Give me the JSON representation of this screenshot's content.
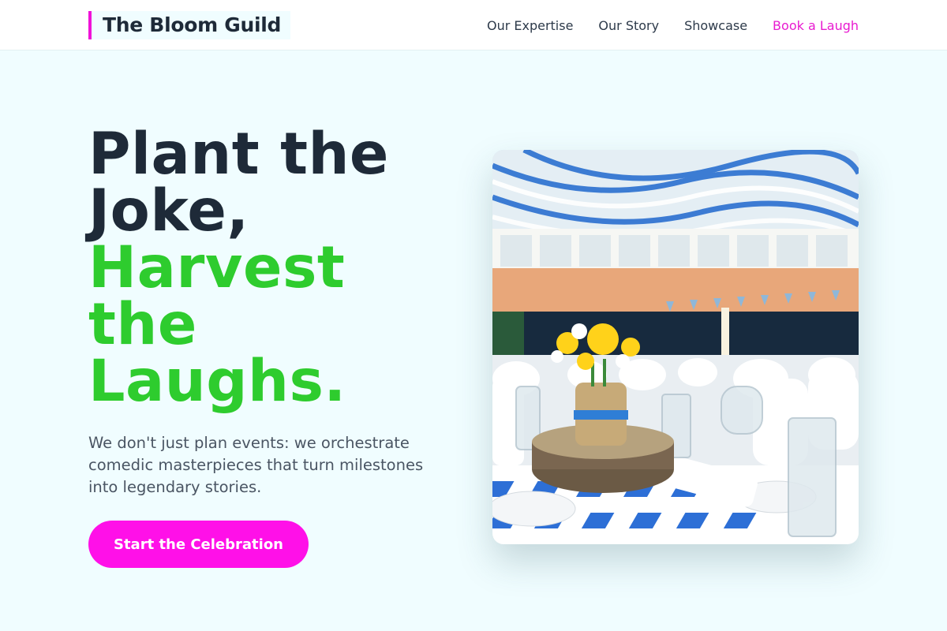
{
  "brand": {
    "name": "The Bloom Guild",
    "accent": "#f012d8"
  },
  "nav": {
    "items": [
      "Our Expertise",
      "Our Story",
      "Showcase"
    ],
    "cta_label": "Book a Laugh"
  },
  "hero": {
    "headline_line1": "Plant the Joke,",
    "headline_accent": "Harvest the Laughs.",
    "lead": "We don't just plan events: we orchestrate comedic masterpieces that turn milestones into legendary stories.",
    "button_label": "Start the Celebration",
    "colors": {
      "headline": "#1e2a38",
      "accent": "#2ecc2e",
      "button": "#ff10e8"
    }
  },
  "image": {
    "subject": "banquet-hall-table-with-flower-jar-centerpiece"
  }
}
